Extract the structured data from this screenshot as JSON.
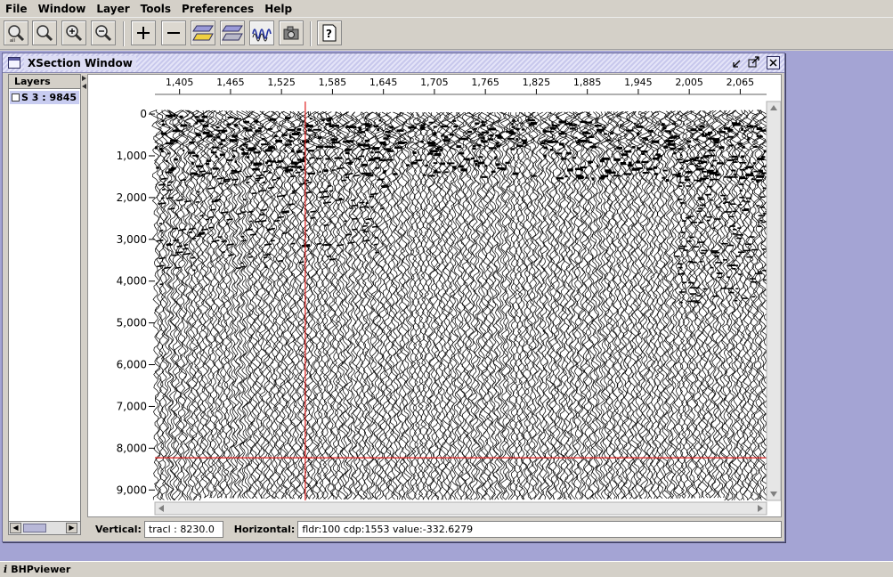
{
  "menubar": {
    "items": [
      "File",
      "Window",
      "Layer",
      "Tools",
      "Preferences",
      "Help"
    ]
  },
  "toolbar": {
    "buttons": [
      {
        "icon": "zoom-all-icon"
      },
      {
        "icon": "zoom-icon"
      },
      {
        "icon": "zoom-in-icon"
      },
      {
        "icon": "zoom-out-icon"
      },
      {
        "icon": "add-icon"
      },
      {
        "icon": "remove-icon"
      },
      {
        "icon": "layer-yellow-icon"
      },
      {
        "icon": "layer-gray-icon"
      },
      {
        "icon": "wiggle-trace-icon"
      },
      {
        "icon": "snapshot-camera-icon"
      },
      {
        "icon": "help-icon"
      }
    ]
  },
  "window": {
    "title": "XSection Window",
    "controls": [
      "minimize",
      "maximize",
      "close"
    ]
  },
  "layers": {
    "header": "Layers",
    "items": [
      {
        "label": "S 3 : 9845"
      }
    ]
  },
  "plot": {
    "x_ticks": [
      "1,405",
      "1,465",
      "1,525",
      "1,585",
      "1,645",
      "1,705",
      "1,765",
      "1,825",
      "1,885",
      "1,945",
      "2,005",
      "2,065"
    ],
    "y_ticks": [
      "0",
      "1,000",
      "2,000",
      "3,000",
      "4,000",
      "5,000",
      "6,000",
      "7,000",
      "8,000",
      "9,000"
    ],
    "cursor_cdp": 1553,
    "cursor_time": 8230,
    "cursor_color": "#e02020",
    "trace_color": "#000000"
  },
  "status": {
    "vertical_label": "Vertical:",
    "vertical_value": "tracl : 8230.0",
    "horizontal_label": "Horizontal:",
    "horizontal_value": "fldr:100 cdp:1553 value:-332.6279"
  },
  "taskbar": {
    "app_label": "BHPviewer"
  },
  "colors": {
    "desktop": "#a4a4d4",
    "chrome": "#d4d0c8",
    "selection": "#c8ccf0"
  }
}
